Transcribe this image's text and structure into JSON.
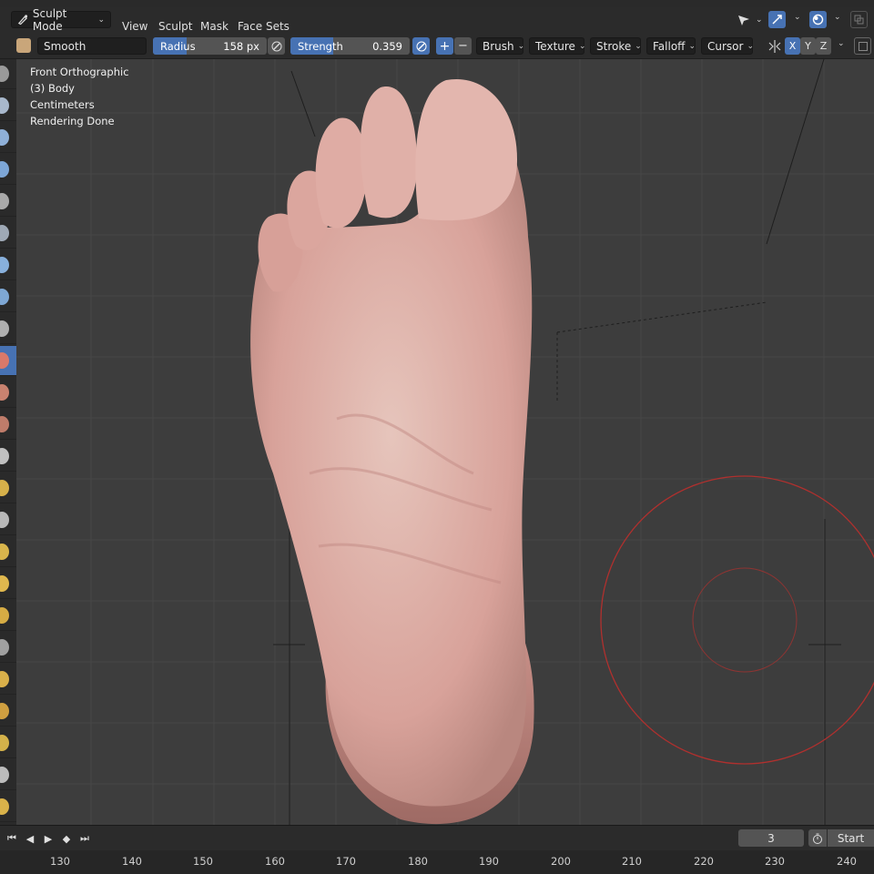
{
  "header": {
    "mode": "Sculpt Mode",
    "menus": [
      "View",
      "Sculpt",
      "Mask",
      "Face Sets"
    ]
  },
  "tool_settings": {
    "brush_name": "Smooth",
    "radius_label": "Radius",
    "radius_value": "158 px",
    "strength_label": "Strength",
    "strength_value": "0.359",
    "plus": "+",
    "minus": "−",
    "dropdowns": [
      "Brush",
      "Texture",
      "Stroke",
      "Falloff",
      "Cursor"
    ],
    "axes": [
      "X",
      "Y",
      "Z"
    ]
  },
  "viewport_info": {
    "view": "Front Orthographic",
    "object": "(3) Body",
    "units": "Centimeters",
    "status": "Rendering Done"
  },
  "timeline": {
    "current_frame": "3",
    "start_label": "Start",
    "ruler": [
      "130",
      "140",
      "150",
      "160",
      "170",
      "180",
      "190",
      "200",
      "210",
      "220",
      "230",
      "240"
    ]
  },
  "colors": {
    "accent": "#4772b3",
    "brush_cursor": "#b0302e",
    "skin": "#d9a49a"
  }
}
